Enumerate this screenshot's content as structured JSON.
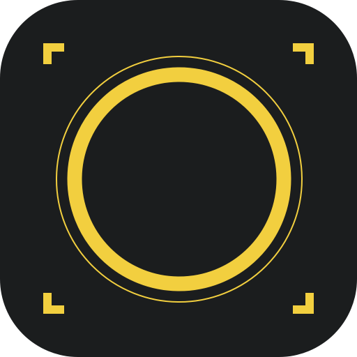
{
  "app_icon": {
    "icon_name": "camera-lens-app-icon",
    "colors": {
      "background": "#1b1d1e",
      "accent": "#f2cf3f",
      "page": "#ffffff"
    },
    "elements": {
      "tile": "rounded-square-background",
      "outer_ring": "thin-outer-ring",
      "inner_ring": "thick-lens-ring",
      "viewfinder_corners": [
        "top-left",
        "top-right",
        "bottom-left",
        "bottom-right"
      ]
    }
  }
}
